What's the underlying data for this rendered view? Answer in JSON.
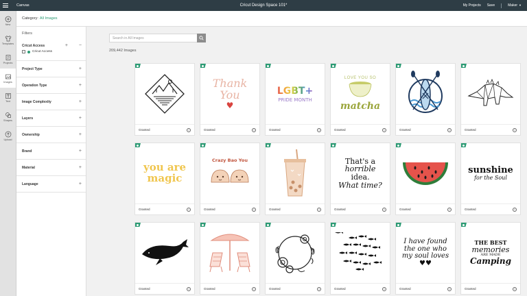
{
  "topbar": {
    "app_name": "Canvas",
    "doc_title": "Cricut Design Space 101*",
    "my_projects": "My Projects",
    "save": "Save",
    "machine": "Maker"
  },
  "rail": {
    "items": [
      {
        "label": "New",
        "icon": "plus-circle-icon"
      },
      {
        "label": "Templates",
        "icon": "shirt-icon"
      },
      {
        "label": "Projects",
        "icon": "projects-icon"
      },
      {
        "label": "Images",
        "icon": "images-icon"
      },
      {
        "label": "Text",
        "icon": "text-icon"
      },
      {
        "label": "Shapes",
        "icon": "shapes-icon"
      },
      {
        "label": "Upload",
        "icon": "upload-icon"
      }
    ]
  },
  "category": {
    "label": "Category:",
    "value": "All Images"
  },
  "filters": {
    "title": "Filters",
    "access": {
      "title": "Cricut Access",
      "option": "Cricut Access"
    },
    "groups": [
      "Project Type",
      "Operation Type",
      "Image Complexity",
      "Layers",
      "Ownership",
      "Brand",
      "Material",
      "Language"
    ]
  },
  "search": {
    "placeholder": "Search in All Images",
    "value": ""
  },
  "results": {
    "count": "209,442 Images"
  },
  "cards": {
    "status": "Granted",
    "items": [
      {
        "name": "mountain-diamond-image"
      },
      {
        "name": "thank-you-image",
        "text": [
          "Thank",
          "You"
        ]
      },
      {
        "name": "lgbt-pride-image",
        "text": [
          "LGBT+",
          "PRIDE MONTH"
        ]
      },
      {
        "name": "love-you-matcha-image",
        "text": [
          "LOVE YOU SO",
          "matcha"
        ]
      },
      {
        "name": "paddleboard-circle-image"
      },
      {
        "name": "geometric-dinosaur-image"
      },
      {
        "name": "you-are-magic-image",
        "text": [
          "you are",
          "magic"
        ]
      },
      {
        "name": "crazy-bao-you-image",
        "text": [
          "Crazy Bao You"
        ]
      },
      {
        "name": "bubble-tea-image"
      },
      {
        "name": "horrible-idea-image",
        "text": [
          "That's a",
          "horrible",
          "idea.",
          "What time?"
        ]
      },
      {
        "name": "watermelon-image"
      },
      {
        "name": "sunshine-soul-image",
        "text": [
          "sunshine",
          "for the Soul"
        ]
      },
      {
        "name": "whale-image"
      },
      {
        "name": "beach-chairs-image"
      },
      {
        "name": "floral-wreath-image"
      },
      {
        "name": "fish-school-image"
      },
      {
        "name": "found-the-one-image",
        "text": [
          "I have found",
          "the one who",
          "my soul loves"
        ]
      },
      {
        "name": "best-memories-camping-image",
        "text": [
          "THE BEST",
          "memories",
          "ARE MADE",
          "Camping"
        ]
      }
    ]
  },
  "colors": {
    "topbar": "#2e3d45",
    "accent": "#2c9b74",
    "pink": "#e8b4a4",
    "matcha": "#a9b43a",
    "watermelon": "#e5534b"
  }
}
